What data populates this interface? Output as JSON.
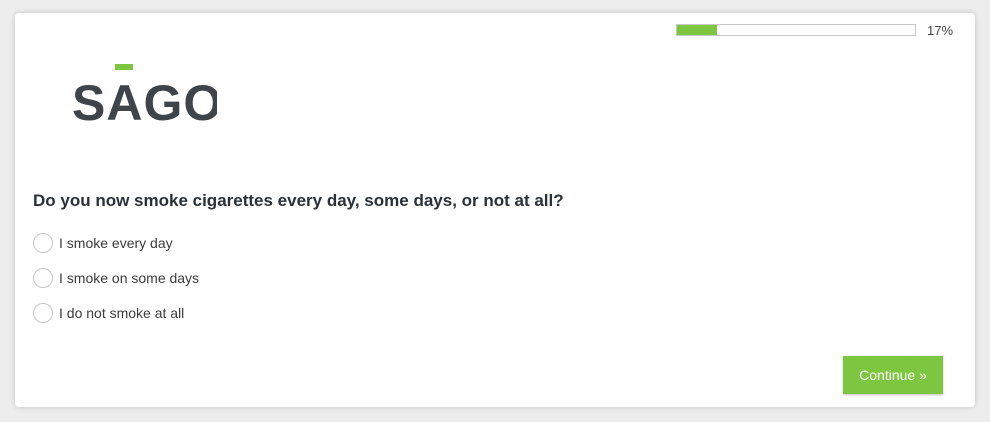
{
  "progress": {
    "percent_text": "17%",
    "value": 0.17,
    "fill_color": "#7dc63f"
  },
  "logo": {
    "text": "SAGO",
    "accent_color": "#7dc63f"
  },
  "question": {
    "text": "Do you now smoke cigarettes every day, some days, or not at all?",
    "options": [
      "I smoke every day",
      "I smoke on some days",
      "I do not smoke at all"
    ]
  },
  "buttons": {
    "continue_label": "Continue »",
    "color": "#7dc63f"
  }
}
